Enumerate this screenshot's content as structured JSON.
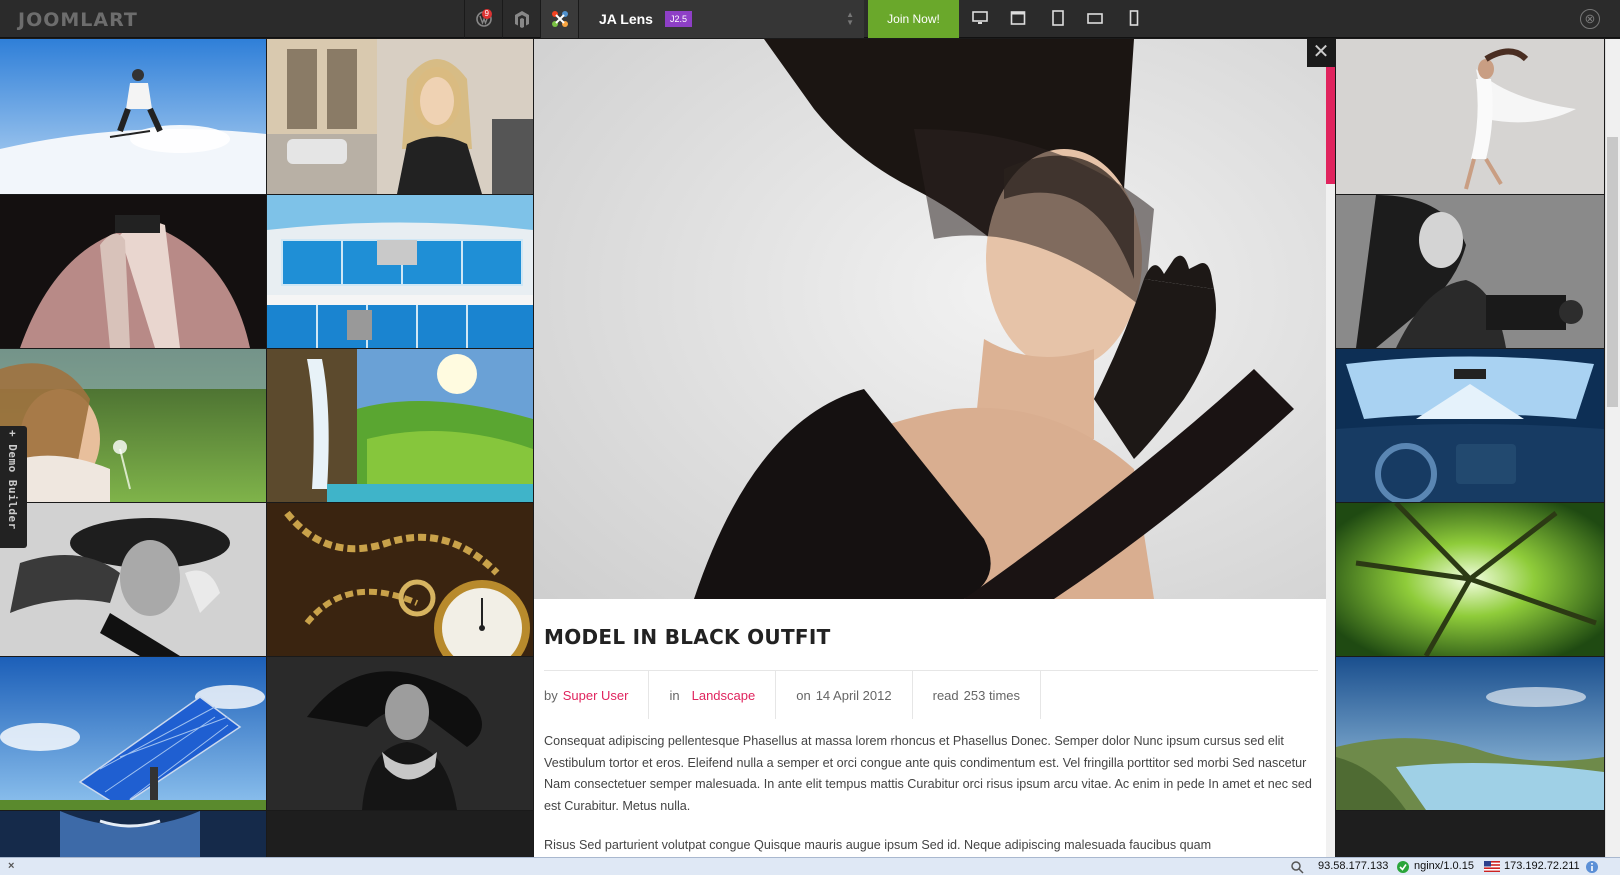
{
  "toolbar": {
    "logo": "JOOMLART",
    "theme_name": "JA Lens",
    "theme_version": "J2.5",
    "join_label": "Join Now!",
    "notification_count": "9",
    "close_symbol": "⊗"
  },
  "article": {
    "title": "MODEL IN BLACK OUTFIT",
    "by_label": "by",
    "author": "Super User",
    "in_label": "in",
    "category": "Landscape",
    "on_label": "on",
    "date": "14 April 2012",
    "read_label": "read",
    "reads": "253 times",
    "paragraph_1": "Consequat adipiscing pellentesque Phasellus at massa lorem rhoncus et Phasellus Donec. Semper dolor Nunc ipsum cursus sed elit Vestibulum tortor et eros. Eleifend nulla a semper et orci congue ante quis condimentum est. Vel fringilla porttitor sed morbi Sed nascetur Nam consectetuer semper malesuada. In ante elit tempus mattis Curabitur orci risus ipsum arcu vitae. Ac enim in pede In amet et nec sed est Curabitur. Metus nulla.",
    "paragraph_2": "Risus Sed parturient volutpat congue Quisque mauris augue ipsum Sed id. Neque adipiscing malesuada faucibus quam",
    "close_symbol": "✕"
  },
  "demo_builder": {
    "label": "+ Demo Builder"
  },
  "statusbar": {
    "close": "×",
    "ip_1": "93.58.177.133",
    "server": "nginx/1.0.15",
    "ip_2": "173.192.72.211"
  },
  "colors": {
    "accent": "#e0245e",
    "join_green": "#6aa82b",
    "version_purple": "#8e3fc6"
  }
}
